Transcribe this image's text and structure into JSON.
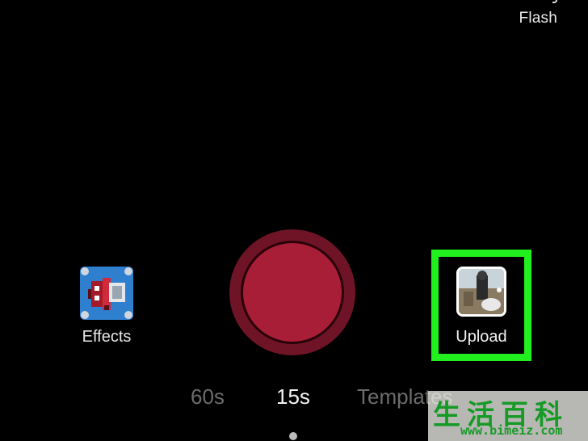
{
  "top_bar": {
    "flash_label": "Flash",
    "flash_icon": "flash-icon"
  },
  "effects": {
    "label": "Effects",
    "icon": "effects-thumbnail-icon",
    "thumb_color": "#2f7fcf"
  },
  "record": {
    "icon": "record-icon",
    "outer_color": "#6e1426",
    "inner_color": "#a81e37"
  },
  "upload": {
    "label": "Upload",
    "icon": "upload-thumbnail-icon",
    "highlight_color": "#22f01e"
  },
  "durations": {
    "items": [
      {
        "label": "60s",
        "active": false
      },
      {
        "label": "15s",
        "active": true
      },
      {
        "label": "Templates",
        "active": false
      }
    ]
  },
  "watermark": {
    "chars": "生活百科",
    "url": "www.bimeiz.com"
  }
}
